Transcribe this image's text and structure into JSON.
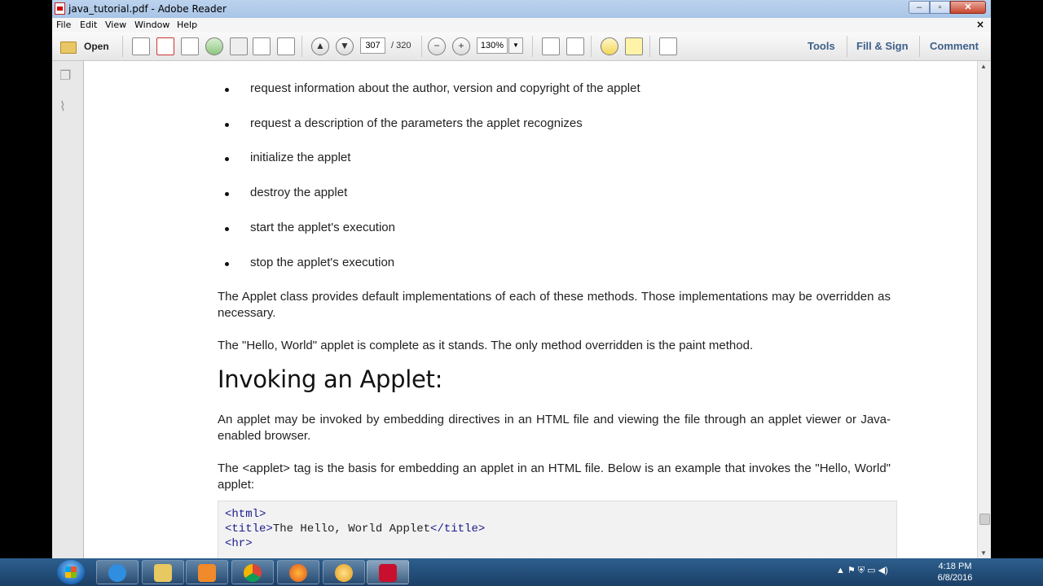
{
  "window": {
    "title": "java_tutorial.pdf - Adobe Reader",
    "min": "–",
    "max": "▫",
    "close": "✕"
  },
  "menu": {
    "file": "File",
    "edit": "Edit",
    "view": "View",
    "window": "Window",
    "help": "Help",
    "doc_close": "×"
  },
  "toolbar": {
    "open_label": "Open",
    "page_current": "307",
    "page_total": "/ 320",
    "zoom": "130%",
    "tools": "Tools",
    "fill_sign": "Fill & Sign",
    "comment": "Comment"
  },
  "document": {
    "bullets": [
      "request information about the author, version and copyright of the applet",
      "request a description of the parameters the applet recognizes",
      "initialize the applet",
      "destroy the applet",
      "start the applet's execution",
      "stop the applet's execution"
    ],
    "para1": "The Applet class provides default implementations of each of these methods. Those implementations may be overridden as necessary.",
    "para2": "The \"Hello, World\" applet is complete as it stands. The only method overridden is the paint method.",
    "heading": "Invoking an Applet:",
    "para3": "An applet may be invoked by embedding directives in an HTML file and viewing the file through an applet viewer or Java-enabled browser.",
    "para4": "The <applet> tag is the basis for embedding an applet in an HTML file. Below is an example that invokes the \"Hello, World\" applet:",
    "code": {
      "line1_tag": "<html>",
      "line2_open": "<title>",
      "line2_text": "The Hello, World Applet",
      "line2_close": "</title>",
      "line3_tag": "<hr>"
    }
  },
  "taskbar": {
    "time": "4:18 PM",
    "date": "6/8/2016",
    "tray_icons": "▲  ⚑  ⛨  ▭  ◀)"
  },
  "colors": {
    "titlebar": "#a9c4e6",
    "link_text": "#3e5f8a",
    "taskbar": "#1b3f66"
  }
}
